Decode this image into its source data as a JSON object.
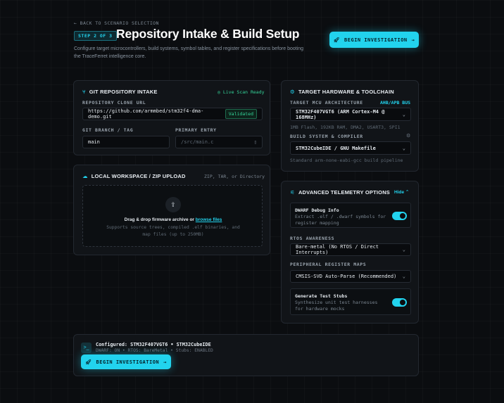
{
  "header": {
    "back_link": "← BACK TO SCENARIO SELECTION",
    "step_badge": "STEP 2 OF 3",
    "title": "Repository Intake & Build Setup",
    "subtitle": "Configure target microcontrollers, build systems, symbol tables, and register specifications before booting the TraceFerret intelligence core.",
    "begin_button": "BEGIN INVESTIGATION"
  },
  "git": {
    "title": "GIT REPOSITORY INTAKE",
    "status": "Live Scan Ready",
    "url_label": "REPOSITORY CLONE URL",
    "url_value": "https://github.com/armmbed/stm32f4-dma-demo.git",
    "url_badge": "Validated",
    "branch_label": "GIT BRANCH / TAG",
    "branch_value": "main",
    "entry_label": "PRIMARY ENTRY",
    "entry_placeholder": "/src/main.c"
  },
  "upload": {
    "title": "LOCAL WORKSPACE / ZIP UPLOAD",
    "formats": "ZIP, TAR, or Directory",
    "drop_text": "Drag & drop firmware archive or",
    "browse_link": "browse files",
    "support_text": "Supports source trees, compiled .elf binaries, and map files (up to 250MB)"
  },
  "hardware": {
    "title": "TARGET HARDWARE & TOOLCHAIN",
    "mcu_label": "TARGET MCU ARCHITECTURE",
    "bus_label": "AHB/APB BUS",
    "mcu_value": "STM32F407VGT6 (ARM Cortex-M4 @ 168MHz)",
    "mcu_hint": "1MB Flash, 192KB RAM, DMA2, USART3, SPI1",
    "build_label": "BUILD SYSTEM & COMPILER",
    "build_value": "STM32CubeIDE / GNU Makefile",
    "build_hint": "Standard arm-none-eabi-gcc build pipeline"
  },
  "telemetry": {
    "title": "ADVANCED TELEMETRY OPTIONS",
    "toggle_label": "Hide",
    "dwarf_title": "DWARF Debug Info",
    "dwarf_desc": "Extract .elf / .dwarf symbols for register mapping",
    "rtos_label": "RTOS AWARENESS",
    "rtos_value": "Bare-metal (No RTOS / Direct Interrupts)",
    "periph_label": "PERIPHERAL REGISTER MAPS",
    "periph_value": "CMSIS-SVD Auto-Parse (Recommended)",
    "stubs_title": "Generate Test Stubs",
    "stubs_desc": "Synthesize unit test harnesses for hardware mocks"
  },
  "footer": {
    "configured": "Configured: STM32F407VGT6 • STM32CubeIDE",
    "details": "DWARF: ON • RTOS: BareMetal • Stubs: ENABLED",
    "begin_button": "BEGIN INVESTIGATION"
  },
  "colors": {
    "accent": "#22d3ee",
    "success": "#34d399",
    "background": "#0b0d10"
  }
}
